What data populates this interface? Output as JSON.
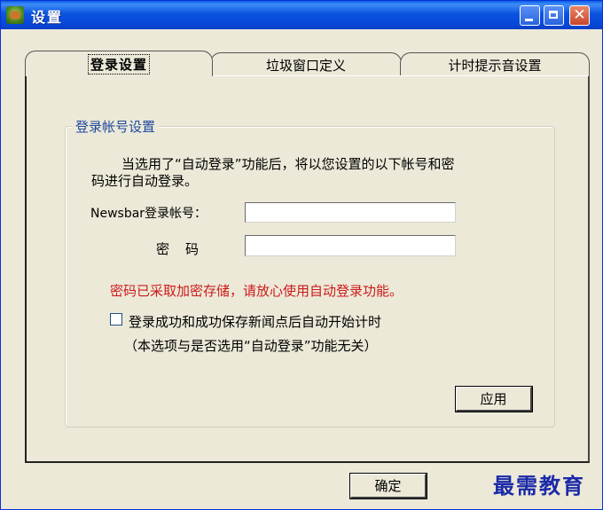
{
  "window": {
    "title": "设置"
  },
  "title_buttons": {
    "close_glyph": "✕"
  },
  "tabs": [
    {
      "label": "登录设置",
      "active": true
    },
    {
      "label": "垃圾窗口定义",
      "active": false
    },
    {
      "label": "计时提示音设置",
      "active": false
    }
  ],
  "group": {
    "title": "登录帐号设置",
    "description_line1": "当选用了“自动登录”功能后，将以您设置的以下帐号和密",
    "description_line2": "码进行自动登录。",
    "account_label": "Newsbar登录帐号：",
    "account_value": "",
    "password_label": "密码",
    "password_value": "",
    "warning": "密码已采取加密存储，请放心使用自动登录功能。",
    "checkbox_label": "登录成功和成功保存新闻点后自动开始计时",
    "checkbox_checked": false,
    "checkbox_note": "（本选项与是否选用“自动登录”功能无关）",
    "apply_label": "应用"
  },
  "footer": {
    "ok_label": "确定"
  },
  "watermark": "最需教育",
  "colors": {
    "titlebar": "#0b54e0",
    "dialog_bg": "#ece9d8",
    "group_title": "#1f4aa0",
    "warning": "#cc1a1a",
    "watermark": "#1b2aa8"
  },
  "icons": {
    "app": "app-icon",
    "minimize": "minimize-icon",
    "maximize": "maximize-icon",
    "close": "close-icon"
  }
}
